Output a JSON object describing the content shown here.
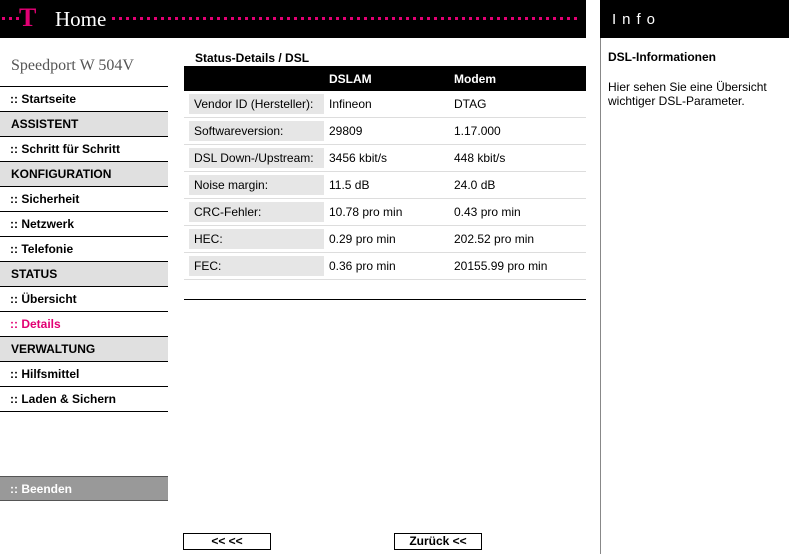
{
  "header": {
    "logo": "T",
    "home": "Home",
    "info_title": "Info"
  },
  "sidebar": {
    "brand": "Speedport W 504V",
    "items": [
      {
        "label": ":: Startseite",
        "type": "link"
      },
      {
        "label": "ASSISTENT",
        "type": "section"
      },
      {
        "label": ":: Schritt für Schritt",
        "type": "link"
      },
      {
        "label": "KONFIGURATION",
        "type": "section"
      },
      {
        "label": ":: Sicherheit",
        "type": "link"
      },
      {
        "label": ":: Netzwerk",
        "type": "link"
      },
      {
        "label": ":: Telefonie",
        "type": "link"
      },
      {
        "label": "STATUS",
        "type": "section"
      },
      {
        "label": ":: Übersicht",
        "type": "link"
      },
      {
        "label": ":: Details",
        "type": "active"
      },
      {
        "label": "VERWALTUNG",
        "type": "section"
      },
      {
        "label": ":: Hilfsmittel",
        "type": "link"
      },
      {
        "label": ":: Laden & Sichern",
        "type": "link"
      }
    ],
    "logout": ":: Beenden"
  },
  "main": {
    "title": "Status-Details / DSL",
    "columns": [
      "DSLAM",
      "Modem"
    ],
    "rows": [
      {
        "label": "Vendor ID (Hersteller):",
        "dslam": "Infineon",
        "modem": "DTAG"
      },
      {
        "label": "Softwareversion:",
        "dslam": "29809",
        "modem": "1.17.000"
      },
      {
        "label": "DSL Down-/Upstream:",
        "dslam": "3456 kbit/s",
        "modem": "448 kbit/s"
      },
      {
        "label": "Noise margin:",
        "dslam": "11.5 dB",
        "modem": "24.0 dB"
      },
      {
        "label": "CRC-Fehler:",
        "dslam": "10.78 pro min",
        "modem": "0.43 pro min"
      },
      {
        "label": "HEC:",
        "dslam": "0.29 pro min",
        "modem": "202.52 pro min"
      },
      {
        "label": "FEC:",
        "dslam": "0.36 pro min",
        "modem": "20155.99 pro min"
      }
    ],
    "btn_prev": "<<  <<",
    "btn_back": "Zurück <<"
  },
  "info": {
    "heading": "DSL-Informationen",
    "text": "Hier sehen Sie eine Übersicht wichtiger DSL-Parameter."
  },
  "colors": {
    "magenta": "#e20074",
    "black": "#000000",
    "section_bg": "#e0e0e0"
  }
}
